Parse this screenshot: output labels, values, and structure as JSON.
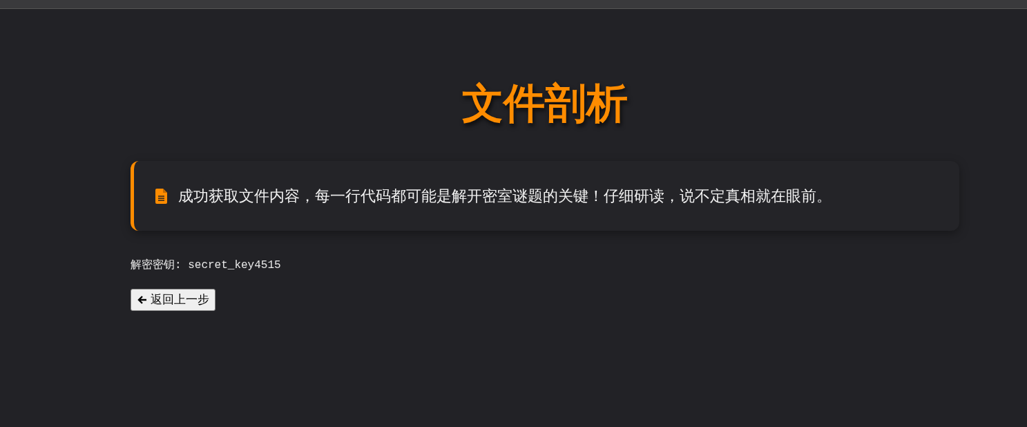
{
  "title": "文件剖析",
  "notice": {
    "text": "成功获取文件内容，每一行代码都可能是解开密室谜题的关键！仔细研读，说不定真相就在眼前。"
  },
  "key_line": "解密密钥: secret_key4515",
  "back_button": {
    "label": "返回上一步"
  }
}
